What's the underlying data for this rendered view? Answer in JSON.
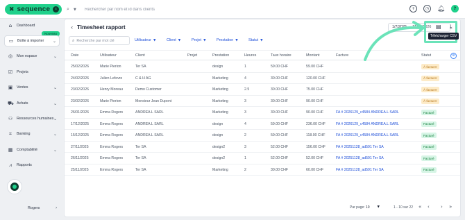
{
  "app": {
    "brand": "sequence",
    "brand_badge": "s",
    "search_placeholder": "Rechercher par nom et id dans clients"
  },
  "sidebar": {
    "new_badge": "Nouveau",
    "items": [
      {
        "label": "Dashboard",
        "icon": "home-icon"
      },
      {
        "label": "Boîte à importer",
        "icon": "inbox-icon"
      },
      {
        "label": "Mon espace",
        "icon": "user-icon"
      },
      {
        "label": "Projets",
        "icon": "checkbox-icon"
      },
      {
        "label": "Ventes",
        "icon": "wallet-icon"
      },
      {
        "label": "Achats",
        "icon": "cart-icon"
      },
      {
        "label": "Ressources humaines",
        "icon": "people-icon"
      },
      {
        "label": "Banking",
        "icon": "bank-icon"
      },
      {
        "label": "Comptabilité",
        "icon": "calculator-icon"
      },
      {
        "label": "Rapports",
        "icon": "chart-icon"
      }
    ],
    "user_name": "Rogers"
  },
  "page": {
    "title": "Timesheet rapport",
    "date_range": "1/7/2025 → 31/12/2026",
    "search_placeholder": "Recherche par mot clé",
    "filters": [
      "Utilisateur",
      "Client",
      "Projet",
      "Prestation",
      "Statut"
    ],
    "tooltip": "Télécharger CSV"
  },
  "table": {
    "headers": [
      "Date",
      "Utilisateur",
      "Client",
      "Projet",
      "Prestation",
      "Heures",
      "Taux horaire",
      "Montant",
      "Facture",
      "Statut"
    ],
    "rows": [
      {
        "date": "25/02/2026",
        "user": "Marie Pierion",
        "client": "Ter SA",
        "project": "",
        "service": "design",
        "hours": "1",
        "rate": "59.00 CHF",
        "amount": "59.00 CHF",
        "invoice": "",
        "status": "À facturer",
        "status_kind": "afacturer"
      },
      {
        "date": "24/02/2026",
        "user": "Julien Lefevre",
        "client": "C & H AG",
        "project": "",
        "service": "Marketing",
        "hours": "4",
        "rate": "30.00 CHF",
        "amount": "120.00 CHF",
        "invoice": "",
        "status": "À facturer",
        "status_kind": "afacturer"
      },
      {
        "date": "23/02/2026",
        "user": "Henry Moreau",
        "client": "Demo Customer",
        "project": "",
        "service": "Marketing",
        "hours": "2.5",
        "rate": "30.00 CHF",
        "amount": "75.00 CHF",
        "invoice": "",
        "status": "À facturer",
        "status_kind": "afacturer"
      },
      {
        "date": "23/02/2026",
        "user": "Marie Pierion",
        "client": "Monsieur Jean Dupont",
        "project": "",
        "service": "Marketing",
        "hours": "3",
        "rate": "30.00 CHF",
        "amount": "90.00 CHF",
        "invoice": "",
        "status": "À facturer",
        "status_kind": "afacturer"
      },
      {
        "date": "26/01/2026",
        "user": "Emma Rogers",
        "client": "ANDREA.L SARL",
        "project": "",
        "service": "Marketing",
        "hours": "3",
        "rate": "30.00 CHF",
        "amount": "90.00 CHF",
        "invoice": "FA # 2026129_c4584 ANDREA.L SARL",
        "status": "Facturé",
        "status_kind": "facture"
      },
      {
        "date": "17/12/2025",
        "user": "Emma Rogers",
        "client": "ANDREA.L SARL",
        "project": "",
        "service": "design",
        "hours": "4",
        "rate": "59.00 CHF",
        "amount": "236.00 CHF",
        "invoice": "FA # 2026129_c4584 ANDREA.L SARL",
        "status": "Facturé",
        "status_kind": "facture"
      },
      {
        "date": "15/12/2025",
        "user": "Emma Rogers",
        "client": "ANDREA.L SARL",
        "project": "",
        "service": "design",
        "hours": "2",
        "rate": "59.00 CHF",
        "amount": "118.00 CHF",
        "invoice": "FA # 2026129_c4584 ANDREA.L SARL",
        "status": "Facturé",
        "status_kind": "facture"
      },
      {
        "date": "27/11/2025",
        "user": "Emma Rogers",
        "client": "Ter SA",
        "project": "",
        "service": "design2",
        "hours": "3",
        "rate": "52.00 CHF",
        "amount": "156.00 CHF",
        "invoice": "FA # 20251128_ad591 Ter SA",
        "status": "Facturé",
        "status_kind": "facture"
      },
      {
        "date": "26/11/2025",
        "user": "Emma Rogers",
        "client": "Ter SA",
        "project": "",
        "service": "design2",
        "hours": "1",
        "rate": "52.00 CHF",
        "amount": "52.00 CHF",
        "invoice": "FA # 20251128_ad591 Ter SA",
        "status": "Facturé",
        "status_kind": "facture"
      },
      {
        "date": "25/11/2025",
        "user": "Emma Rogers",
        "client": "Ter SA",
        "project": "",
        "service": "Marketing",
        "hours": "2",
        "rate": "30.00 CHF",
        "amount": "60.00 CHF",
        "invoice": "FA # 20251128_ad591 Ter SA",
        "status": "Facturé",
        "status_kind": "facture"
      }
    ]
  },
  "pagination": {
    "per_page_label": "Par page:",
    "per_page_value": "10",
    "range": "1 - 10 sur 22"
  },
  "colors": {
    "brand_green": "#1fd18b",
    "link_blue": "#1d4ed8",
    "annotation_green": "#6be3b9"
  }
}
